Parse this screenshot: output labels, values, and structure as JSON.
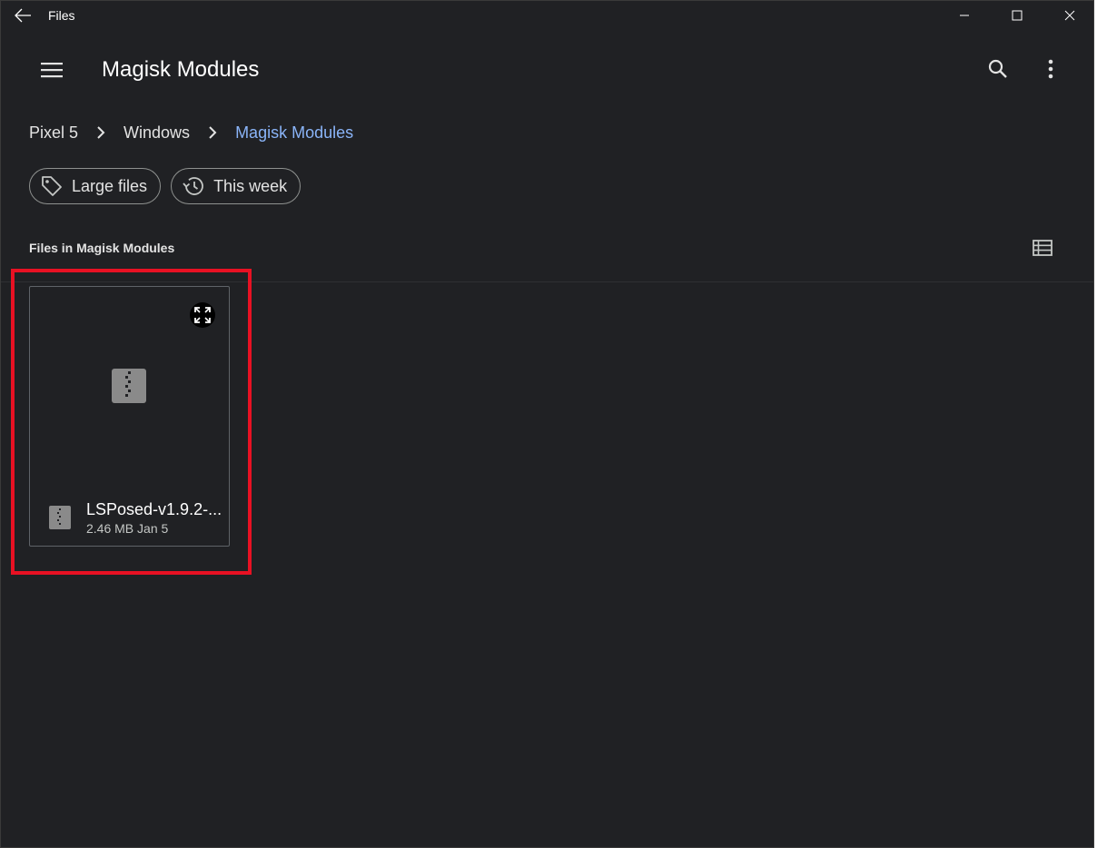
{
  "window": {
    "title": "Files"
  },
  "appbar": {
    "title": "Magisk Modules"
  },
  "breadcrumb": [
    {
      "label": "Pixel 5"
    },
    {
      "label": "Windows"
    },
    {
      "label": "Magisk Modules"
    }
  ],
  "chips": [
    {
      "label": "Large files",
      "icon": "tag-icon"
    },
    {
      "label": "This week",
      "icon": "history-icon"
    }
  ],
  "section": {
    "title": "Files in Magisk Modules"
  },
  "files": [
    {
      "name": "LSPosed-v1.9.2-...",
      "size": "2.46 MB",
      "date": "Jan 5",
      "icon": "zip-file-icon"
    }
  ],
  "colors": {
    "background": "#202124",
    "accent": "#8ab4f8",
    "highlight": "#e81123"
  }
}
